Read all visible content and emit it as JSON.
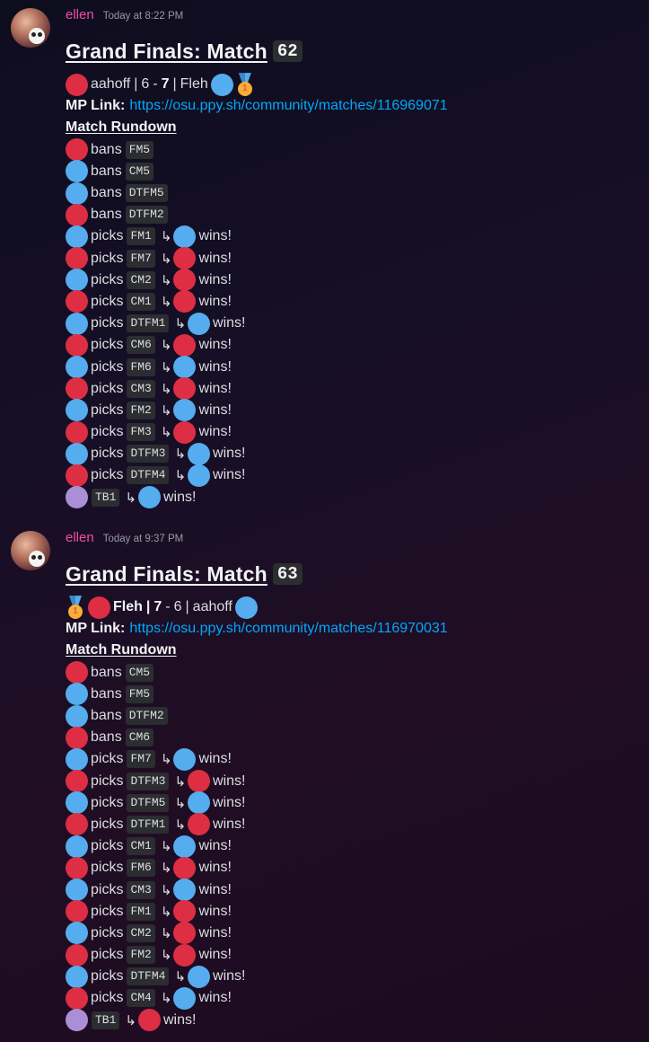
{
  "colors": {
    "team_red": "#dd2e44",
    "team_blue": "#55acee",
    "tiebreaker": "#aa8ed6",
    "username": "#f04ea4",
    "link": "#00a8fc"
  },
  "messages": [
    {
      "username": "ellen",
      "timestamp": "Today at 8:22 PM",
      "title": "Grand Finals: Match",
      "match_number": "62",
      "score": {
        "left_team": "aahoff",
        "left_score": "6",
        "dash": "-",
        "right_score": "7",
        "right_team": "Fleh",
        "sep": "|"
      },
      "mp_label": "MP Link:",
      "mp_url": "https://osu.ppy.sh/community/matches/116969071",
      "rundown_label": "Match Rundown",
      "bans": [
        {
          "team": "red",
          "verb": "bans",
          "map": "FM5"
        },
        {
          "team": "blue",
          "verb": "bans",
          "map": "CM5"
        },
        {
          "team": "blue",
          "verb": "bans",
          "map": "DTFM5"
        },
        {
          "team": "red",
          "verb": "bans",
          "map": "DTFM2"
        }
      ],
      "picks": [
        {
          "team": "blue",
          "verb": "picks",
          "map": "FM1",
          "winner": "blue",
          "result": "wins!"
        },
        {
          "team": "red",
          "verb": "picks",
          "map": "FM7",
          "winner": "red",
          "result": "wins!"
        },
        {
          "team": "blue",
          "verb": "picks",
          "map": "CM2",
          "winner": "red",
          "result": "wins!"
        },
        {
          "team": "red",
          "verb": "picks",
          "map": "CM1",
          "winner": "red",
          "result": "wins!"
        },
        {
          "team": "blue",
          "verb": "picks",
          "map": "DTFM1",
          "winner": "blue",
          "result": "wins!"
        },
        {
          "team": "red",
          "verb": "picks",
          "map": "CM6",
          "winner": "red",
          "result": "wins!"
        },
        {
          "team": "blue",
          "verb": "picks",
          "map": "FM6",
          "winner": "blue",
          "result": "wins!"
        },
        {
          "team": "red",
          "verb": "picks",
          "map": "CM3",
          "winner": "red",
          "result": "wins!"
        },
        {
          "team": "blue",
          "verb": "picks",
          "map": "FM2",
          "winner": "blue",
          "result": "wins!"
        },
        {
          "team": "red",
          "verb": "picks",
          "map": "FM3",
          "winner": "red",
          "result": "wins!"
        },
        {
          "team": "blue",
          "verb": "picks",
          "map": "DTFM3",
          "winner": "blue",
          "result": "wins!"
        },
        {
          "team": "red",
          "verb": "picks",
          "map": "DTFM4",
          "winner": "blue",
          "result": "wins!"
        }
      ],
      "tiebreaker": {
        "map": "TB1",
        "winner": "blue",
        "result": "wins!"
      }
    },
    {
      "username": "ellen",
      "timestamp": "Today at 9:37 PM",
      "title": "Grand Finals: Match",
      "match_number": "63",
      "score": {
        "left_team": "Fleh",
        "left_score": "7",
        "dash": "-",
        "right_score": "6",
        "right_team": "aahoff",
        "sep": "|"
      },
      "mp_label": "MP Link:",
      "mp_url": "https://osu.ppy.sh/community/matches/116970031",
      "rundown_label": "Match Rundown",
      "bans": [
        {
          "team": "red",
          "verb": "bans",
          "map": "CM5"
        },
        {
          "team": "blue",
          "verb": "bans",
          "map": "FM5"
        },
        {
          "team": "blue",
          "verb": "bans",
          "map": "DTFM2"
        },
        {
          "team": "red",
          "verb": "bans",
          "map": "CM6"
        }
      ],
      "picks": [
        {
          "team": "blue",
          "verb": "picks",
          "map": "FM7",
          "winner": "blue",
          "result": "wins!"
        },
        {
          "team": "red",
          "verb": "picks",
          "map": "DTFM3",
          "winner": "red",
          "result": "wins!"
        },
        {
          "team": "blue",
          "verb": "picks",
          "map": "DTFM5",
          "winner": "blue",
          "result": "wins!"
        },
        {
          "team": "red",
          "verb": "picks",
          "map": "DTFM1",
          "winner": "red",
          "result": "wins!"
        },
        {
          "team": "blue",
          "verb": "picks",
          "map": "CM1",
          "winner": "blue",
          "result": "wins!"
        },
        {
          "team": "red",
          "verb": "picks",
          "map": "FM6",
          "winner": "red",
          "result": "wins!"
        },
        {
          "team": "blue",
          "verb": "picks",
          "map": "CM3",
          "winner": "blue",
          "result": "wins!"
        },
        {
          "team": "red",
          "verb": "picks",
          "map": "FM1",
          "winner": "red",
          "result": "wins!"
        },
        {
          "team": "blue",
          "verb": "picks",
          "map": "CM2",
          "winner": "red",
          "result": "wins!"
        },
        {
          "team": "red",
          "verb": "picks",
          "map": "FM2",
          "winner": "red",
          "result": "wins!"
        },
        {
          "team": "blue",
          "verb": "picks",
          "map": "DTFM4",
          "winner": "blue",
          "result": "wins!"
        },
        {
          "team": "red",
          "verb": "picks",
          "map": "CM4",
          "winner": "blue",
          "result": "wins!"
        }
      ],
      "tiebreaker": {
        "map": "TB1",
        "winner": "red",
        "result": "wins!"
      }
    }
  ]
}
